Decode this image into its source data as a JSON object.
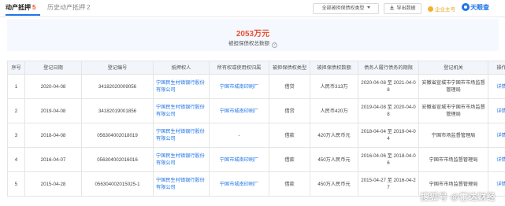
{
  "tabs": [
    {
      "label": "动产抵押",
      "count": "5"
    },
    {
      "label": "历史动产抵押",
      "count": "2"
    }
  ],
  "toolbar": {
    "type_select": "全部被担保债权类型",
    "export": "导出数据",
    "vip": "企业主号",
    "brand": "天眼查"
  },
  "summary": {
    "amount": "2053万元",
    "label": "被担保债权总数额"
  },
  "table": {
    "headers": [
      "序号",
      "登记日期",
      "登记编号",
      "抵押权人",
      "所有权或使用权归属",
      "被担保债权类型",
      "被担保债权数额",
      "债务人履行债务的期限",
      "登记机关",
      "操作"
    ],
    "rows": [
      {
        "no": "1",
        "date": "2020-04-08",
        "reg_no": "34182020009056",
        "mortgagee": "宁国民生村镇银行股份有限公司",
        "owner": "宁国市城南印刷厂",
        "debt_type": "借贷",
        "amount": "人民币313万",
        "term": "2020-04-08 至 2021-04-08",
        "authority": "安徽省宣城市宁国市市场监督管理局",
        "op": "详情"
      },
      {
        "no": "2",
        "date": "2019-04-08",
        "reg_no": "34182019001856",
        "mortgagee": "宁国民生村镇银行股份有限公司",
        "owner": "宁国市城南印刷厂",
        "debt_type": "借贷",
        "amount": "人民币420万",
        "term": "2019-04-08 至 2020-04-08",
        "authority": "安徽省宣城市宁国市市场监督管理局",
        "op": "详情"
      },
      {
        "no": "3",
        "date": "2018-04-08",
        "reg_no": "056304002018019",
        "mortgagee": "宁国民生村镇银行股份有限公司",
        "owner": "-",
        "debt_type": "借款",
        "amount": "420万人民币元",
        "term": "2018-04-04 至 2019-04-04",
        "authority": "宁国市场监督管理局",
        "op": "详情"
      },
      {
        "no": "4",
        "date": "2016-04-07",
        "reg_no": "056304002016016",
        "mortgagee": "宁国民生村镇银行股份有限公司",
        "owner": "宁国市城南印刷厂",
        "debt_type": "借款",
        "amount": "450万人民币元",
        "term": "2016-04-06 至 2018-04-06",
        "authority": "宁国市市场监督管理局",
        "op": "详情"
      },
      {
        "no": "5",
        "date": "2015-04-28",
        "reg_no": "056304002015025-1",
        "mortgagee": "宁国民生村镇银行股份有限公司",
        "owner": "宁国市城南印刷厂",
        "debt_type": "借款",
        "amount": "450万人民币元",
        "term": "2015-04-27 至 2016-04-27",
        "authority": "宁国市市场监督管理局",
        "op": "详情"
      }
    ]
  },
  "watermark": "搜狐号 @雷达财经"
}
